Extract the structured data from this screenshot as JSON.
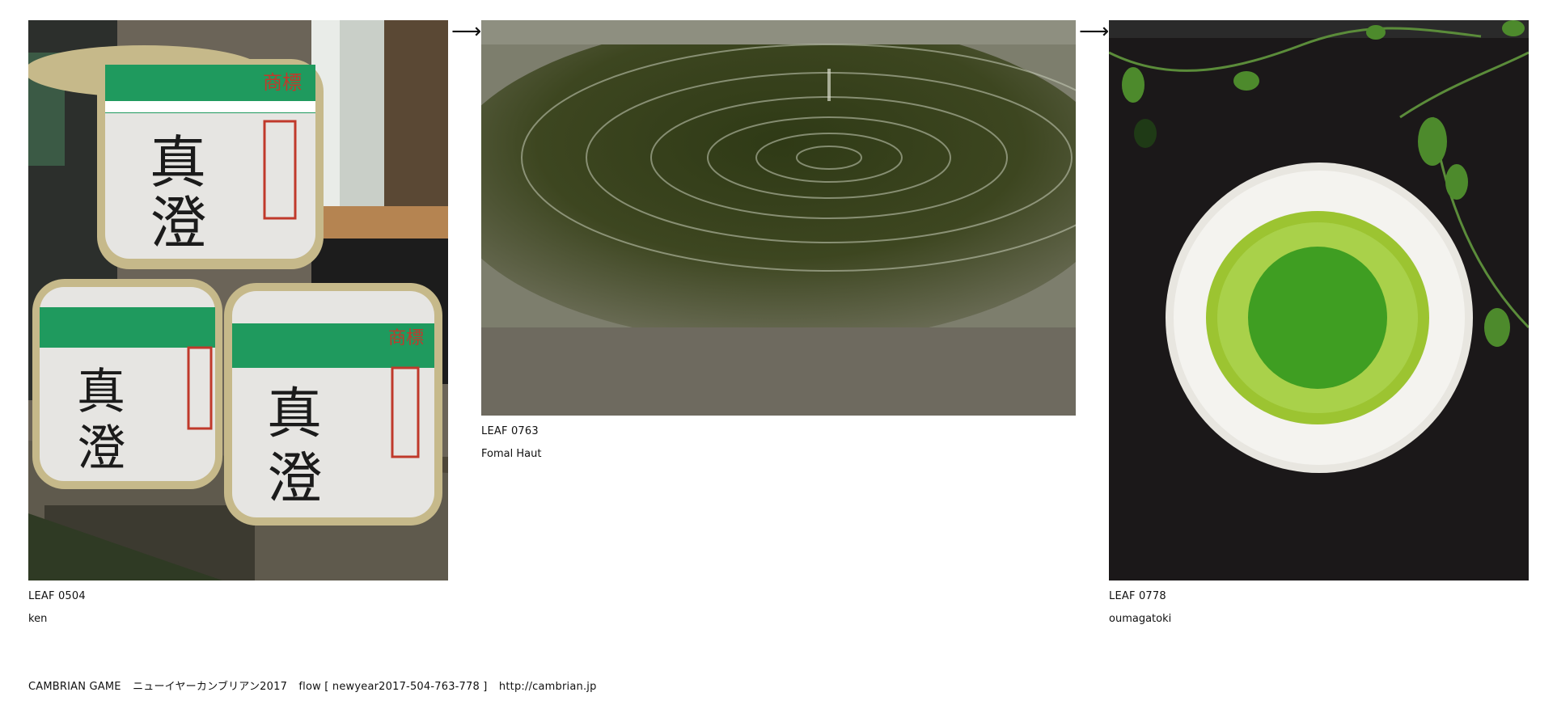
{
  "leaves": [
    {
      "id": "LEAF 0504",
      "name": "ken"
    },
    {
      "id": "LEAF 0763",
      "name": "Fomal Haut"
    },
    {
      "id": "LEAF 0778",
      "name": "oumagatoki"
    }
  ],
  "flow": {
    "arrow_glyph": "⟶"
  },
  "footer": {
    "site": "CAMBRIAN GAME",
    "event": "ニューイヤーカンブリアン2017",
    "flow_label": "flow [ newyear2017-504-763-778 ]",
    "url": "http://cambrian.jp"
  },
  "colors": {
    "background": "#ffffff",
    "text": "#111111",
    "matcha": "#3f9e22",
    "water": "#3d4620",
    "sake_green": "#1f9a5e",
    "label_red": "#c0392b"
  },
  "icons": {
    "arrow": "right-arrow-icon"
  }
}
